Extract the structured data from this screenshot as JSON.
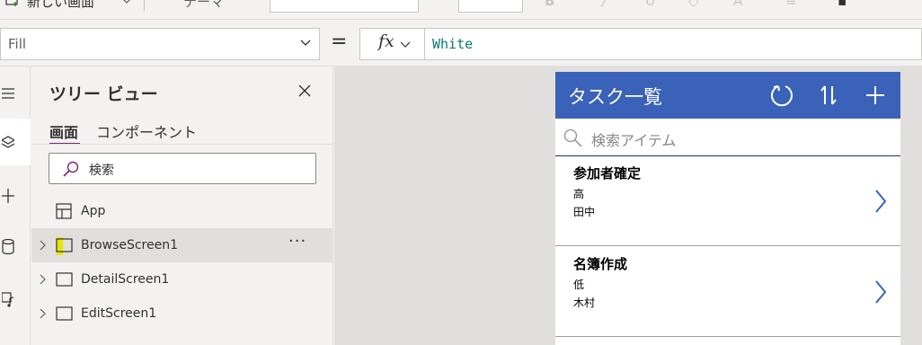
{
  "ribbon": {
    "new_screen_label": "新しい画面",
    "theme_label": "テーマ"
  },
  "formula_bar": {
    "property": "Fill",
    "equals": "=",
    "fx_label": "fx",
    "formula": "White"
  },
  "rail": {
    "items": [
      "menu-icon",
      "layers-icon",
      "insert-icon",
      "data-icon",
      "media-icon"
    ]
  },
  "tree_view": {
    "title": "ツリー ビュー",
    "tabs": [
      {
        "label": "画面",
        "active": true
      },
      {
        "label": "コンポーネント",
        "active": false
      }
    ],
    "search_placeholder": "検索",
    "nodes": [
      {
        "label": "App",
        "icon": "app-icon"
      },
      {
        "label": "BrowseScreen1",
        "icon": "screen-icon",
        "selected": true,
        "more": "···"
      },
      {
        "label": "DetailScreen1",
        "icon": "screen-icon"
      },
      {
        "label": "EditScreen1",
        "icon": "screen-icon"
      }
    ]
  },
  "app_preview": {
    "title": "タスク一覧",
    "header_bg": "#3a62b8",
    "search_placeholder": "検索アイテム",
    "items": [
      {
        "title": "参加者確定",
        "priority": "高",
        "owner": "田中"
      },
      {
        "title": "名簿作成",
        "priority": "低",
        "owner": "木村"
      }
    ]
  }
}
